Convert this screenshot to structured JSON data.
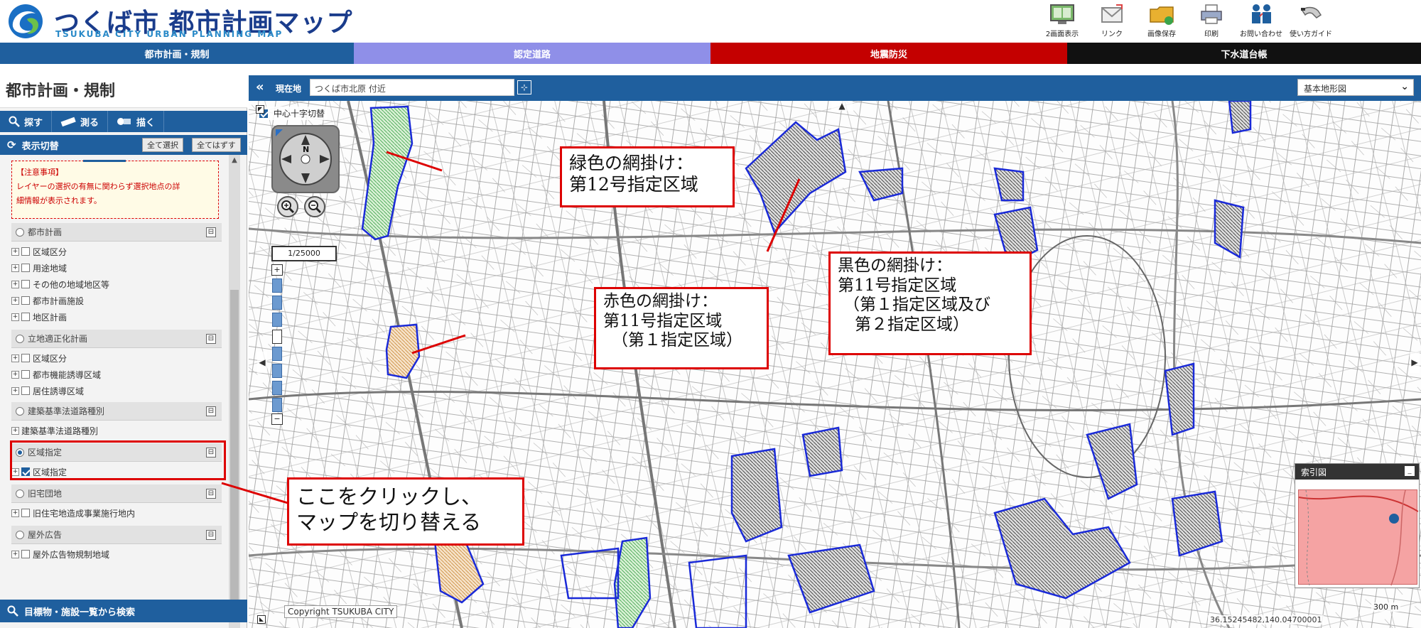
{
  "header": {
    "title": "つくば市 都市計画マップ",
    "subtitle": "TSUKUBA CITY URBAN PLANNING MAP",
    "tools": [
      {
        "label": "2画面表示",
        "icon": "dual-screen-icon"
      },
      {
        "label": "リンク",
        "icon": "link-icon"
      },
      {
        "label": "画像保存",
        "icon": "image-save-icon"
      },
      {
        "label": "印刷",
        "icon": "print-icon"
      },
      {
        "label": "お問い合わせ",
        "icon": "contact-icon"
      },
      {
        "label": "使い方ガイド",
        "icon": "guide-icon"
      }
    ]
  },
  "tabs": [
    {
      "label": "都市計画・規制",
      "color": "#1f5f9e"
    },
    {
      "label": "認定道路",
      "color": "#8f8fe8"
    },
    {
      "label": "地震防災",
      "color": "#c40000"
    },
    {
      "label": "下水道台帳",
      "color": "#111111"
    }
  ],
  "panel": {
    "title": "都市計画・規制",
    "buttons": {
      "search": "探す",
      "measure": "測る",
      "draw": "描く"
    },
    "display_toggle": "表示切替",
    "select_all": "全て選択",
    "deselect_all": "全てはずす",
    "notice": {
      "heading": "【注意事項】",
      "line1": "レイヤーの選択の有無に関わらず選択地点の詳",
      "line2": "細情報が表示されます。"
    },
    "sections": [
      {
        "label": "都市計画",
        "selected": false,
        "collapse": "⊟"
      },
      {
        "label": "立地適正化計画",
        "selected": false,
        "collapse": "⊟"
      },
      {
        "label": "建築基準法道路種別",
        "selected": false,
        "collapse": "⊟"
      },
      {
        "label": "区域指定",
        "selected": true,
        "collapse": "⊟"
      },
      {
        "label": "旧宅団地",
        "selected": false,
        "collapse": "⊟"
      },
      {
        "label": "屋外広告",
        "selected": false,
        "collapse": "⊟"
      }
    ],
    "items": {
      "toshi": [
        "区域区分",
        "用途地域",
        "その他の地域地区等",
        "都市計画施設",
        "地区計画"
      ],
      "ritchi": [
        "区域区分",
        "都市機能誘導区域",
        "居住誘導区域"
      ],
      "kenchiku": [
        "建築基準法道路種別"
      ],
      "kuiki": [
        "区域指定"
      ],
      "kyutaku": [
        "旧住宅地造成事業施行地内"
      ],
      "okugai": [
        "屋外広告物規制地域"
      ]
    },
    "bottom_search": "目標物・施設一覧から検索"
  },
  "mapbar": {
    "collapse": "«",
    "location_label": "現在地",
    "location_value": "つくば市北原 付近",
    "basemap": "基本地形図"
  },
  "map": {
    "crosshair_label": "中心十字切替",
    "scale_ratio": "1/25000",
    "minimap_title": "索引図",
    "scalebar": "300 m",
    "coords": "36.15245482,140.04700001",
    "copyright": "Copyright TSUKUBA CITY",
    "zoom_in": "+",
    "zoom_out": "−"
  },
  "callouts": [
    {
      "line1": "緑色の網掛け：",
      "line2": "第12号指定区域"
    },
    {
      "line1": "赤色の網掛け：",
      "line2": "第11号指定区域",
      "line3": "（第１指定区域）"
    },
    {
      "line1": "黒色の網掛け：",
      "line2": "第11号指定区域",
      "line3": "（第１指定区域及び",
      "line4": "第２指定区域）"
    },
    {
      "line1": "ここをクリックし、",
      "line2": "マップを切り替える"
    }
  ],
  "colors": {
    "accent": "#1f5f9e",
    "callout_border": "#dd0000",
    "zone_outline": "#1a2ad8"
  }
}
